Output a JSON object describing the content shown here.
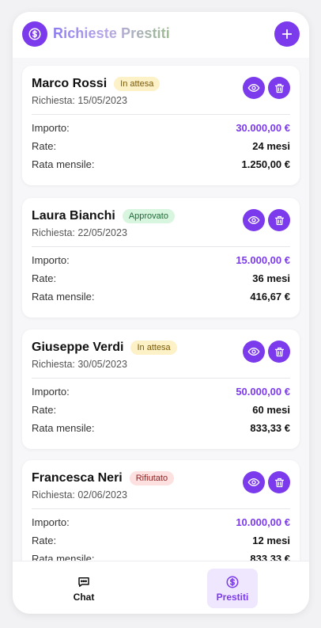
{
  "header": {
    "title": "Richieste Prestiti",
    "logo_icon": "dollar-circle-icon",
    "add_icon": "plus-icon"
  },
  "labels": {
    "importo": "Importo:",
    "rate": "Rate:",
    "rata_mensile": "Rata mensile:"
  },
  "colors": {
    "accent": "#7c3aed"
  },
  "requests": [
    {
      "name": "Marco Rossi",
      "status": "In attesa",
      "status_kind": "pending",
      "date": "Richiesta: 15/05/2023",
      "importo": "30.000,00 €",
      "rate": "24 mesi",
      "rata_mensile": "1.250,00 €"
    },
    {
      "name": "Laura Bianchi",
      "status": "Approvato",
      "status_kind": "approved",
      "date": "Richiesta: 22/05/2023",
      "importo": "15.000,00 €",
      "rate": "36 mesi",
      "rata_mensile": "416,67 €"
    },
    {
      "name": "Giuseppe Verdi",
      "status": "In attesa",
      "status_kind": "pending",
      "date": "Richiesta: 30/05/2023",
      "importo": "50.000,00 €",
      "rate": "60 mesi",
      "rata_mensile": "833,33 €"
    },
    {
      "name": "Francesca Neri",
      "status": "Rifiutato",
      "status_kind": "rejected",
      "date": "Richiesta: 02/06/2023",
      "importo": "10.000,00 €",
      "rate": "12 mesi",
      "rata_mensile": "833,33 €"
    }
  ],
  "nav": {
    "chat_label": "Chat",
    "prestiti_label": "Prestiti"
  }
}
